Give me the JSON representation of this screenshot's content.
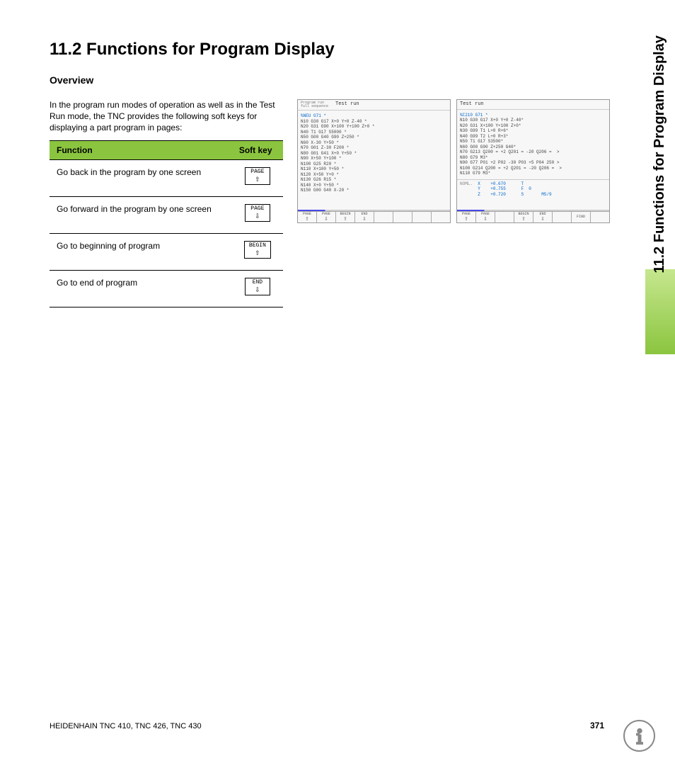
{
  "title": "11.2 Functions for Program Display",
  "subheading": "Overview",
  "intro": "In the program run modes of operation as well as in the Test Run mode, the TNC provides the following soft keys for displaying a part program in pages:",
  "table": {
    "header_function": "Function",
    "header_softkey": "Soft key",
    "rows": [
      {
        "label": "Go back in the program by one screen",
        "key_label": "PAGE",
        "arrow": "⇧"
      },
      {
        "label": "Go forward in the program by one screen",
        "key_label": "PAGE",
        "arrow": "⇩"
      },
      {
        "label": "Go to beginning of program",
        "key_label": "BEGIN",
        "arrow": "⇧"
      },
      {
        "label": "Go to end of program",
        "key_label": "END",
        "arrow": "⇩"
      }
    ]
  },
  "screenshot1": {
    "mode_label_small": "Program run\nfull sequence",
    "mode_title": "Test run",
    "first_line": "%NEU G71 *",
    "code": "N10 G30 G17 X+0 Y+0 Z-40 *\nN20 G31 G90 X+100 Y+100 Z+0 *\nN40 T1 G17 S5000 *\nN50 G00 G40 G90 Z+250 *\nN60 X-30 Y+50 *\nN70 G01 Z-30 F200 *\nN80 G01 G41 X+0 Y+50 *\nN90 X+50 Y+100 *\nN100 G25 R20 *\nN110 X+100 Y+50 *\nN120 X+50 Y+0 *\nN130 G26 R15 *\nN140 X+0 Y+50 *\nN150 G00 G40 X-20 *",
    "softkeys": [
      "PAGE\n⇧",
      "PAGE\n⇩",
      "BEGIN\n⇧",
      "END\n⇩",
      "",
      "",
      "",
      ""
    ]
  },
  "screenshot2": {
    "mode_title": "Test run",
    "first_line": "%C210 G71 *",
    "code": "N10 G30 G17 X+0 Y+0 Z-40*\nN20 G31 X+100 Y+100 Z+0*\nN30 G99 T1 L+0 R+6*\nN40 G99 T2 L+0 R+3*\nN50 T1 G17 S3500*\nN60 G00 G90 Z+250 G40*\nN70 G213 Q200 = +2 Q201 = -20 Q206 =  >\nN80 G79 M3*\nN90 G77 P01 +2 P02 -30 P03 +5 P04 250 >\nN100 G214 Q200 = +2 Q201 = -20 Q206 =  >\nN110 G79 M3*",
    "noml_label": "NOML.",
    "noml_values": "X    +0.670\nY    +0.755\nZ    +0.720",
    "status_right": "T\nF  0\nS       M5/9",
    "softkeys": [
      "PAGE\n⇧",
      "PAGE\n⇩",
      "",
      "BEGIN\n⇧",
      "END\n⇩",
      "",
      "FIND",
      ""
    ]
  },
  "side_text": "11.2 Functions for Program Display",
  "footer_left": "HEIDENHAIN TNC 410, TNC 426, TNC 430",
  "footer_page": "371"
}
